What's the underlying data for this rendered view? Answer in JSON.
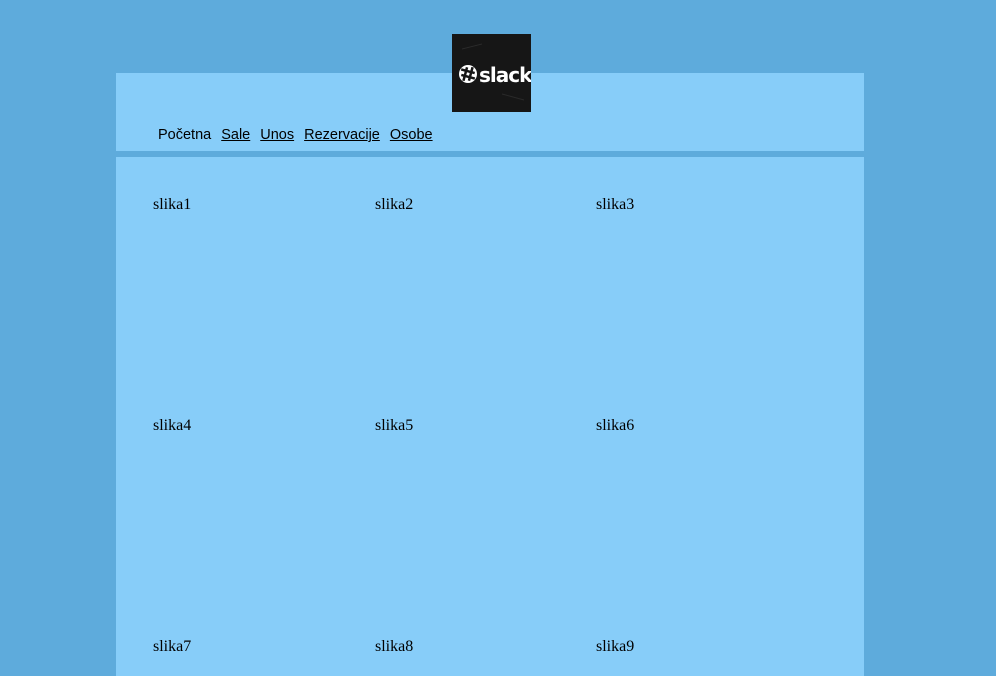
{
  "logo": {
    "icon": "slack-logo",
    "text": "slack"
  },
  "nav": {
    "items": [
      {
        "label": "Početna",
        "link": false
      },
      {
        "label": "Sale",
        "link": true
      },
      {
        "label": "Unos",
        "link": true
      },
      {
        "label": "Rezervacije",
        "link": true
      },
      {
        "label": "Osobe",
        "link": true
      }
    ]
  },
  "gallery": {
    "items": [
      {
        "label": "slika1"
      },
      {
        "label": "slika2"
      },
      {
        "label": "slika3"
      },
      {
        "label": "slika4"
      },
      {
        "label": "slika5"
      },
      {
        "label": "slika6"
      },
      {
        "label": "slika7"
      },
      {
        "label": "slika8"
      },
      {
        "label": "slika9"
      }
    ]
  },
  "colors": {
    "page_background": "#5eabdc",
    "panel_background": "#87cdf9",
    "logo_background": "#161616"
  }
}
